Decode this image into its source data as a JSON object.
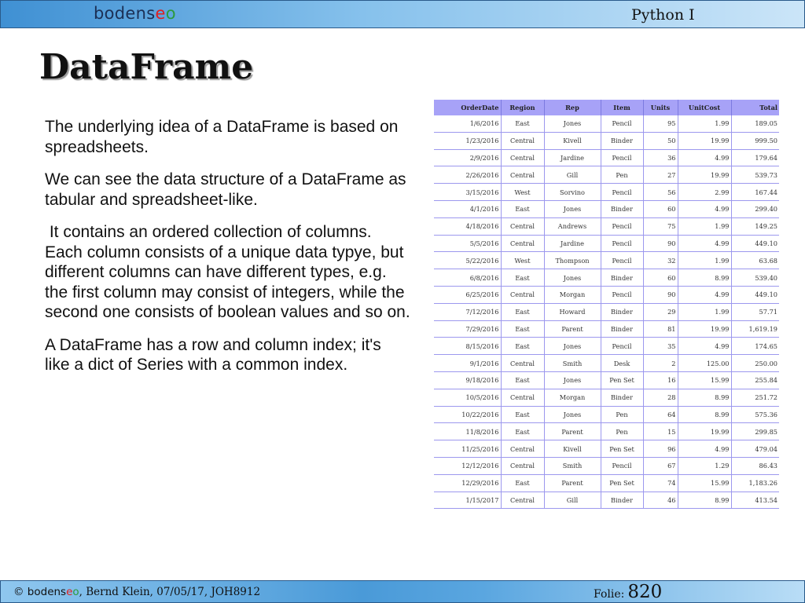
{
  "header": {
    "logo_prefix": "bodens",
    "logo_e": "e",
    "logo_o": "o",
    "course": "Python I"
  },
  "title": "DataFrame",
  "paragraphs": [
    "The underlying idea of a DataFrame is based on spreadsheets.",
    "We can see the data structure of a DataFrame as tabular and spreadsheet-like.",
    " It contains an ordered collection of columns. Each column consists of a unique data typye, but different columns can have different types, e.g. the first column may consist of integers, while the second one consists of boolean values and so on.",
    "A DataFrame has a row and column index; it's like a dict of Series with a common index."
  ],
  "table": {
    "columns": [
      "OrderDate",
      "Region",
      "Rep",
      "Item",
      "Units",
      "UnitCost",
      "Total"
    ],
    "rows": [
      [
        "1/6/2016",
        "East",
        "Jones",
        "Pencil",
        "95",
        "1.99",
        "189.05"
      ],
      [
        "1/23/2016",
        "Central",
        "Kivell",
        "Binder",
        "50",
        "19.99",
        "999.50"
      ],
      [
        "2/9/2016",
        "Central",
        "Jardine",
        "Pencil",
        "36",
        "4.99",
        "179.64"
      ],
      [
        "2/26/2016",
        "Central",
        "Gill",
        "Pen",
        "27",
        "19.99",
        "539.73"
      ],
      [
        "3/15/2016",
        "West",
        "Sorvino",
        "Pencil",
        "56",
        "2.99",
        "167.44"
      ],
      [
        "4/1/2016",
        "East",
        "Jones",
        "Binder",
        "60",
        "4.99",
        "299.40"
      ],
      [
        "4/18/2016",
        "Central",
        "Andrews",
        "Pencil",
        "75",
        "1.99",
        "149.25"
      ],
      [
        "5/5/2016",
        "Central",
        "Jardine",
        "Pencil",
        "90",
        "4.99",
        "449.10"
      ],
      [
        "5/22/2016",
        "West",
        "Thompson",
        "Pencil",
        "32",
        "1.99",
        "63.68"
      ],
      [
        "6/8/2016",
        "East",
        "Jones",
        "Binder",
        "60",
        "8.99",
        "539.40"
      ],
      [
        "6/25/2016",
        "Central",
        "Morgan",
        "Pencil",
        "90",
        "4.99",
        "449.10"
      ],
      [
        "7/12/2016",
        "East",
        "Howard",
        "Binder",
        "29",
        "1.99",
        "57.71"
      ],
      [
        "7/29/2016",
        "East",
        "Parent",
        "Binder",
        "81",
        "19.99",
        "1,619.19"
      ],
      [
        "8/15/2016",
        "East",
        "Jones",
        "Pencil",
        "35",
        "4.99",
        "174.65"
      ],
      [
        "9/1/2016",
        "Central",
        "Smith",
        "Desk",
        "2",
        "125.00",
        "250.00"
      ],
      [
        "9/18/2016",
        "East",
        "Jones",
        "Pen Set",
        "16",
        "15.99",
        "255.84"
      ],
      [
        "10/5/2016",
        "Central",
        "Morgan",
        "Binder",
        "28",
        "8.99",
        "251.72"
      ],
      [
        "10/22/2016",
        "East",
        "Jones",
        "Pen",
        "64",
        "8.99",
        "575.36"
      ],
      [
        "11/8/2016",
        "East",
        "Parent",
        "Pen",
        "15",
        "19.99",
        "299.85"
      ],
      [
        "11/25/2016",
        "Central",
        "Kivell",
        "Pen Set",
        "96",
        "4.99",
        "479.04"
      ],
      [
        "12/12/2016",
        "Central",
        "Smith",
        "Pencil",
        "67",
        "1.29",
        "86.43"
      ],
      [
        "12/29/2016",
        "East",
        "Parent",
        "Pen Set",
        "74",
        "15.99",
        "1,183.26"
      ],
      [
        "1/15/2017",
        "Central",
        "Gill",
        "Binder",
        "46",
        "8.99",
        "413.54"
      ]
    ]
  },
  "footer": {
    "copyright": "© ",
    "brand_prefix": "bodens",
    "brand_e": "e",
    "brand_o": "o",
    "author_info": ", Bernd Klein, 07/05/17, JOH8912",
    "folie_label": "Folie:",
    "folie_number": "820"
  }
}
